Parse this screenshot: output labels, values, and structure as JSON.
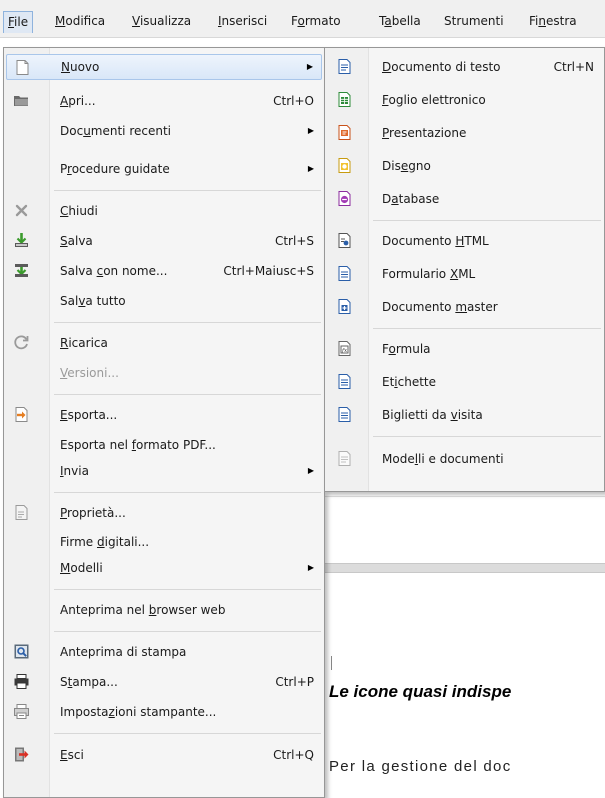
{
  "menubar": {
    "items": [
      "File",
      "Modifica",
      "Visualizza",
      "Inserisci",
      "Formato",
      "Tabella",
      "Strumenti",
      "Finestra"
    ]
  },
  "file_menu": {
    "nuovo": "Nuovo",
    "apri": "Apri...",
    "apri_shortcut": "Ctrl+O",
    "documenti_recenti": "Documenti recenti",
    "procedure_guidate": "Procedure guidate",
    "chiudi": "Chiudi",
    "salva": "Salva",
    "salva_shortcut": "Ctrl+S",
    "salva_con_nome": "Salva con nome...",
    "salva_con_nome_shortcut": "Ctrl+Maiusc+S",
    "salva_tutto": "Salva tutto",
    "ricarica": "Ricarica",
    "versioni": "Versioni...",
    "esporta": "Esporta...",
    "esporta_pdf": "Esporta nel formato PDF...",
    "invia": "Invia",
    "proprieta": "Proprietà...",
    "firme_digitali": "Firme digitali...",
    "modelli": "Modelli",
    "anteprima_browser": "Anteprima nel browser web",
    "anteprima_stampa": "Anteprima di stampa",
    "stampa": "Stampa...",
    "stampa_shortcut": "Ctrl+P",
    "impostazioni_stampante": "Impostazioni stampante...",
    "esci": "Esci",
    "esci_shortcut": "Ctrl+Q"
  },
  "nuovo_menu": {
    "documento_testo": "Documento di testo",
    "documento_testo_shortcut": "Ctrl+N",
    "foglio_elettronico": "Foglio elettronico",
    "presentazione": "Presentazione",
    "disegno": "Disegno",
    "database": "Database",
    "documento_html": "Documento HTML",
    "formulario_xml": "Formulario XML",
    "documento_master": "Documento master",
    "formula": "Formula",
    "etichette": "Etichette",
    "biglietti_visita": "Biglietti da visita",
    "modelli_documenti": "Modelli e documenti"
  },
  "document": {
    "heading": "Le icone quasi indispe",
    "body": "Per la gestione del doc"
  },
  "colors": {
    "highlight": "#d9e7f8",
    "highlight_border": "#a9c6ea",
    "menu_bg": "#f5f5f5",
    "disabled_text": "#9a9a9a"
  }
}
